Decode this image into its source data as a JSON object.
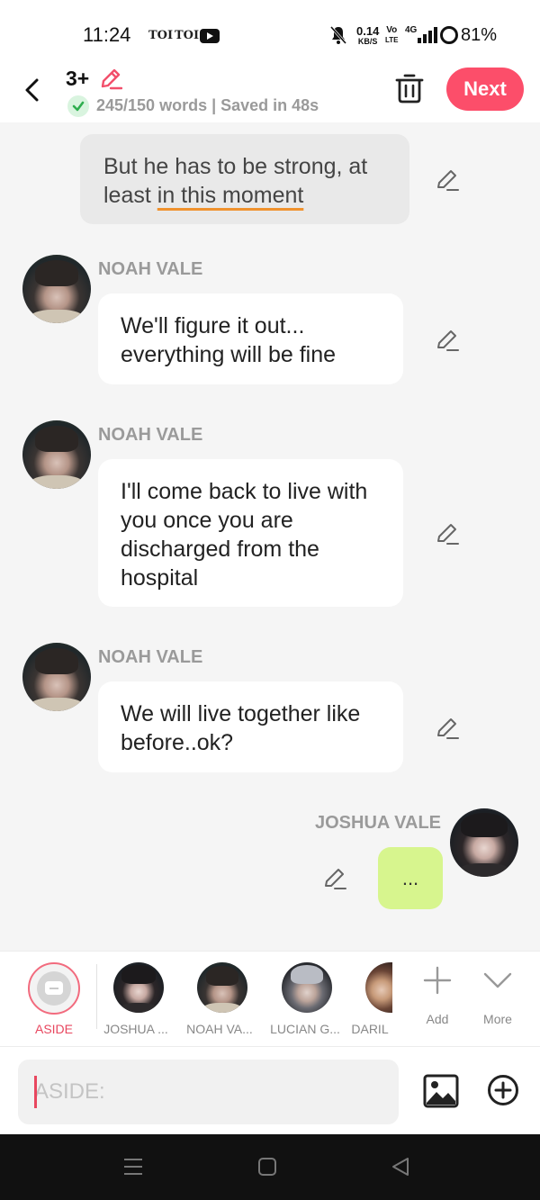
{
  "status_bar": {
    "time": "11:24",
    "app_icon_1": "TOI",
    "app_icon_2": "TOI",
    "app_icon_3": "youtube-icon",
    "net_speed_value": "0.14",
    "net_speed_unit": "KB/S",
    "volte_top": "Vo",
    "volte_bottom": "LTE",
    "network": "4G",
    "battery": "81%"
  },
  "header": {
    "title_count": "3+",
    "word_status": "245/150 words | Saved in 48s",
    "next_label": "Next"
  },
  "chat": {
    "narration": {
      "text_before": "But he has to be strong, at least ",
      "text_underlined": "in this moment"
    },
    "messages": [
      {
        "speaker": "NOAH VALE",
        "text": "We'll figure it out... everything will be fine"
      },
      {
        "speaker": "NOAH VALE",
        "text": "I'll come back to live with you once you are discharged from the hospital"
      },
      {
        "speaker": "NOAH VALE",
        "text": "We will live together like before..ok?"
      }
    ],
    "reply": {
      "speaker": "JOSHUA VALE",
      "text": "..."
    }
  },
  "character_bar": {
    "aside_label": "ASIDE",
    "characters": [
      {
        "label": "JOSHUA ..."
      },
      {
        "label": "NOAH VA..."
      },
      {
        "label": "LUCIAN G..."
      },
      {
        "label": "DARIL"
      }
    ],
    "add_label": "Add",
    "more_label": "More"
  },
  "input_bar": {
    "placeholder": "ASIDE:"
  },
  "colors": {
    "accent": "#fc4e6a",
    "typing_bubble": "#d7f58e",
    "underline": "#f0922e"
  }
}
